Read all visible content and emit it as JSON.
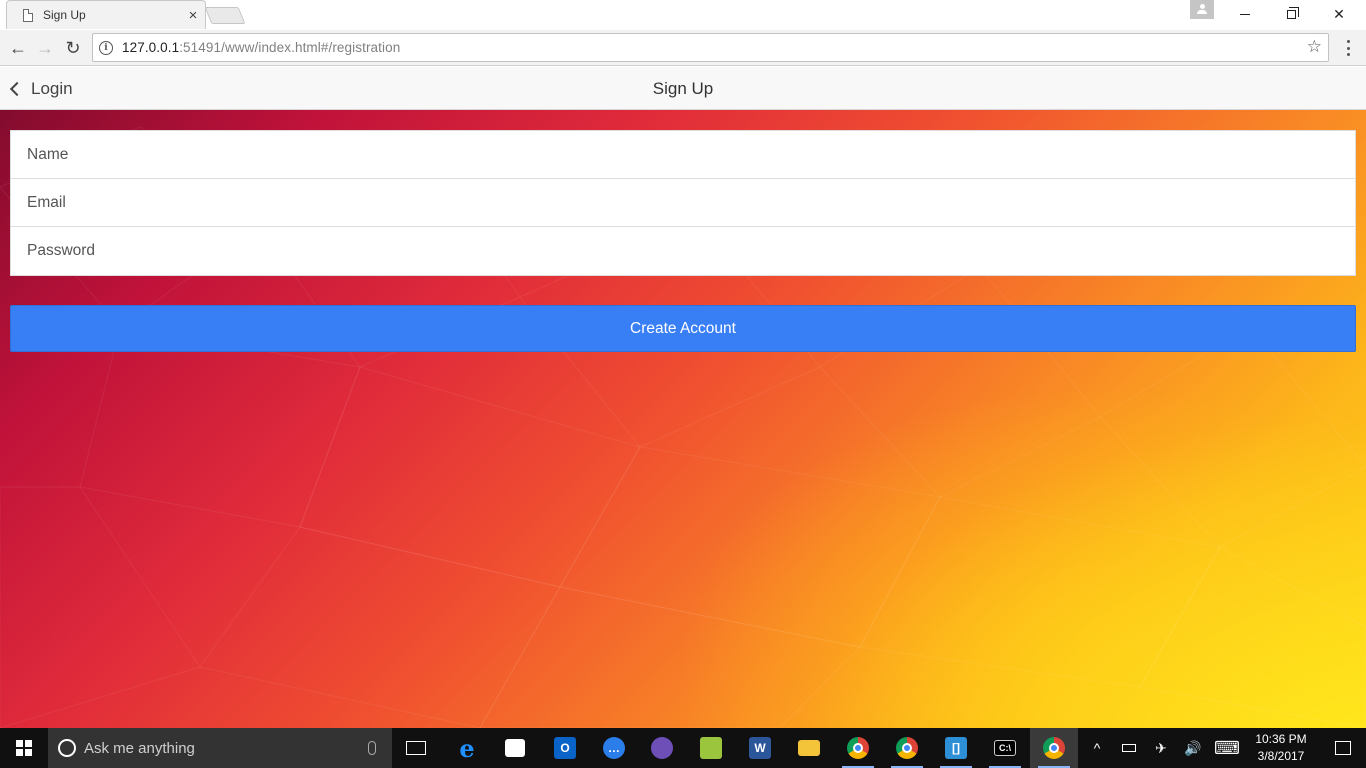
{
  "browser": {
    "tab_title": "Sign Up",
    "tab_close": "×",
    "url_host": "127.0.0.1",
    "url_rest": ":51491/www/index.html#/registration",
    "star": "☆",
    "back": "←",
    "forward": "→",
    "reload": "↻",
    "win_close": "✕"
  },
  "header": {
    "back_label": "Login",
    "title": "Sign Up"
  },
  "form": {
    "name_placeholder": "Name",
    "email_placeholder": "Email",
    "password_placeholder": "Password",
    "submit_label": "Create Account"
  },
  "taskbar": {
    "search_placeholder": "Ask me anything",
    "time": "10:36 PM",
    "date": "3/8/2017",
    "tray_up": "^",
    "tray_volume": "🔊",
    "tray_plane": "✈",
    "tray_keyboard": "⌨"
  },
  "colors": {
    "primary_button": "#387ef5",
    "taskbar": "#101010",
    "header_bg": "#f8f8f8"
  }
}
